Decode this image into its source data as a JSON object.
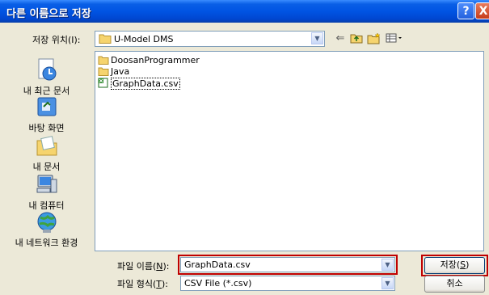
{
  "window": {
    "title": "다른 이름으로 저장",
    "help_glyph": "?",
    "close_glyph": "X"
  },
  "save_in": {
    "label": "저장 위치(I):",
    "value": "U-Model DMS"
  },
  "toolbar": {
    "icons": [
      "back-arrow-icon",
      "up-folder-icon",
      "new-folder-icon",
      "view-menu-icon"
    ]
  },
  "places": [
    {
      "label": "내 최근 문서",
      "icon": "recent-documents-icon"
    },
    {
      "label": "바탕 화면",
      "icon": "desktop-icon"
    },
    {
      "label": "내 문서",
      "icon": "my-documents-icon"
    },
    {
      "label": "내 컴퓨터",
      "icon": "my-computer-icon"
    },
    {
      "label": "내 네트워크 환경",
      "icon": "network-places-icon"
    }
  ],
  "files": [
    {
      "name": "DoosanProgrammer",
      "type": "folder"
    },
    {
      "name": "Java",
      "type": "folder"
    },
    {
      "name": "GraphData.csv",
      "type": "csv"
    }
  ],
  "file_name": {
    "label_pre": "파일 이름(",
    "label_key": "N",
    "label_post": "):",
    "value": "GraphData.csv"
  },
  "file_type": {
    "label_pre": "파일 형식(",
    "label_key": "T",
    "label_post": "):",
    "value": "CSV File (*.csv)"
  },
  "buttons": {
    "save_pre": "저장(",
    "save_key": "S",
    "save_post": ")",
    "cancel": "취소"
  },
  "colors": {
    "title_bar": "#0054e3",
    "highlight": "#c00000",
    "dialog_bg": "#ece9d8"
  }
}
